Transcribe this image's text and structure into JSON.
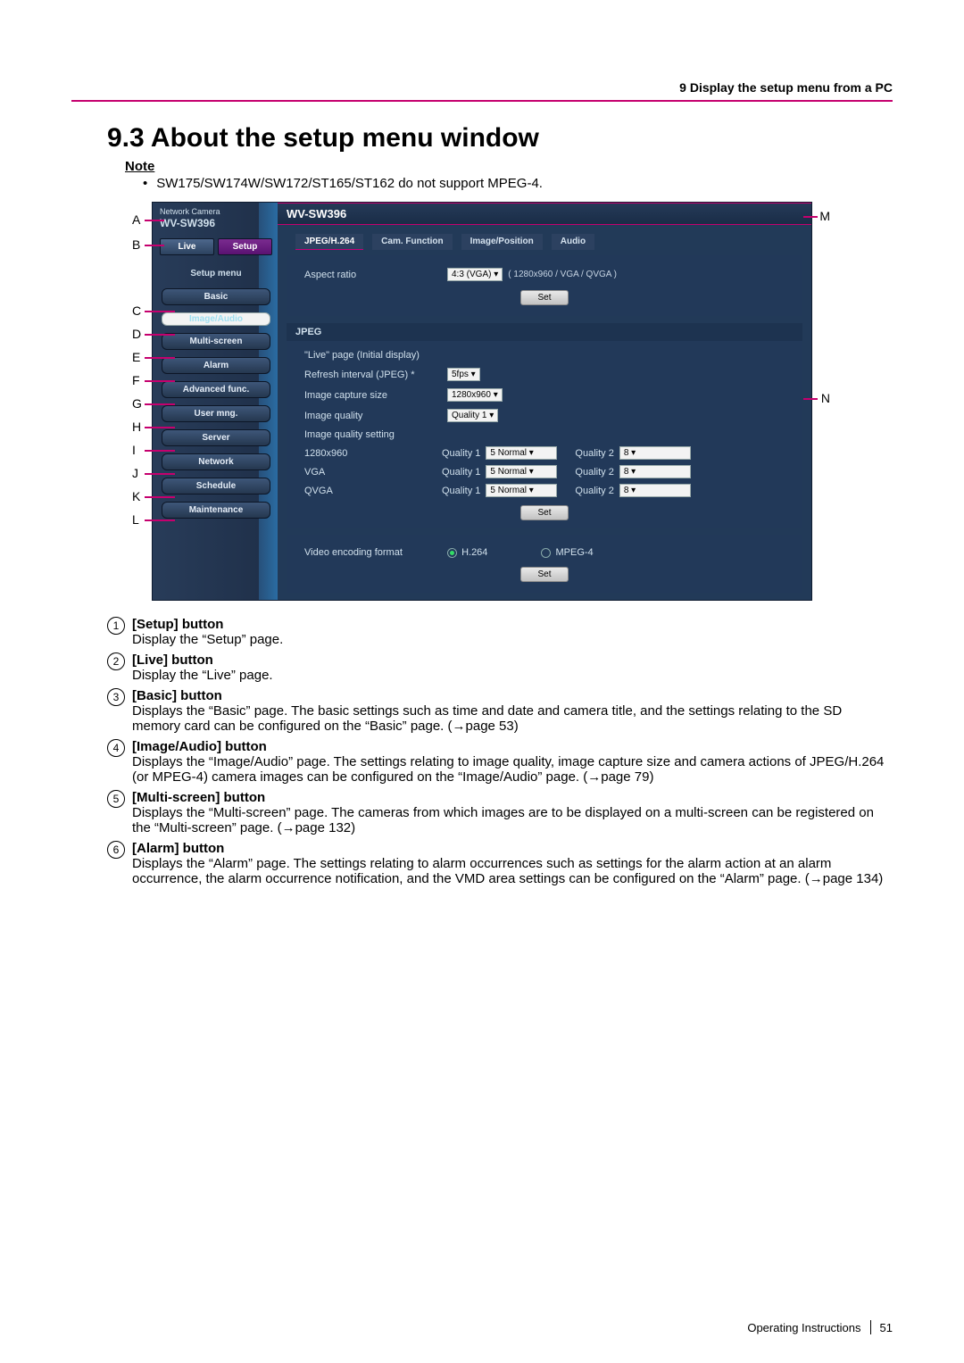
{
  "header": {
    "breadcrumb": "9 Display the setup menu from a PC",
    "h1": "9.3   About the setup menu window"
  },
  "note": {
    "heading": "Note",
    "bullet": "•",
    "text": "SW175/SW174W/SW172/ST165/ST162 do not support MPEG-4."
  },
  "markers_left": [
    "A",
    "B",
    "C",
    "D",
    "E",
    "F",
    "G",
    "H",
    "I",
    "J",
    "K",
    "L"
  ],
  "markers_right": [
    "M",
    "N"
  ],
  "cam": {
    "brand_line": "Network Camera",
    "brand_model": "WV-SW396",
    "titlebar": "WV-SW396",
    "tabs": {
      "live": "Live",
      "setup": "Setup"
    },
    "menu_title": "Setup menu",
    "menu": [
      "Basic",
      "Image/Audio",
      "Multi-screen",
      "Alarm",
      "Advanced func.",
      "User mng.",
      "Server",
      "Network",
      "Schedule",
      "Maintenance"
    ],
    "subtabs": [
      "JPEG/H.264",
      "Cam. Function",
      "Image/Position",
      "Audio"
    ],
    "aspect": {
      "label": "Aspect ratio",
      "value": "4:3 (VGA)",
      "hint": "( 1280x960 / VGA / QVGA )"
    },
    "set_btn": "Set",
    "jpeg_head": "JPEG",
    "live_init": "\"Live\" page (Initial display)",
    "refresh": {
      "label": "Refresh interval (JPEG) *",
      "value": "5fps"
    },
    "capture": {
      "label": "Image capture size",
      "value": "1280x960"
    },
    "iq": {
      "label": "Image quality",
      "value": "Quality 1"
    },
    "iq_head": "Image quality setting",
    "iq_rows": [
      {
        "size": "1280x960",
        "q1l": "Quality 1",
        "q1": "5 Normal",
        "q2l": "Quality 2",
        "q2": "8"
      },
      {
        "size": "VGA",
        "q1l": "Quality 1",
        "q1": "5 Normal",
        "q2l": "Quality 2",
        "q2": "8"
      },
      {
        "size": "QVGA",
        "q1l": "Quality 1",
        "q1": "5 Normal",
        "q2l": "Quality 2",
        "q2": "8"
      }
    ],
    "enc": {
      "label": "Video encoding format",
      "h264": "H.264",
      "mpeg4": "MPEG-4"
    }
  },
  "defs": [
    {
      "n": "1",
      "title": "[Setup] button",
      "body": "Display the “Setup” page."
    },
    {
      "n": "2",
      "title": "[Live] button",
      "body": "Display the “Live” page."
    },
    {
      "n": "3",
      "title": "[Basic] button",
      "body": "Displays the “Basic” page. The basic settings such as time and date and camera title, and the settings relating to the SD memory card can be configured on the “Basic” page. (→page 53)"
    },
    {
      "n": "4",
      "title": "[Image/Audio] button",
      "body": "Displays the “Image/Audio” page. The settings relating to image quality, image capture size and camera actions of JPEG/H.264 (or MPEG-4) camera images can be configured on the “Image/Audio” page. (→page 79)"
    },
    {
      "n": "5",
      "title": "[Multi-screen] button",
      "body": "Displays the “Multi-screen” page. The cameras from which images are to be displayed on a multi-screen can be registered on the “Multi-screen” page. (→page 132)"
    },
    {
      "n": "6",
      "title": "[Alarm] button",
      "body": "Displays the “Alarm” page. The settings relating to alarm occurrences such as settings for the alarm action at an alarm occurrence, the alarm occurrence notification, and the VMD area settings can be configured on the “Alarm” page. (→page 134)"
    }
  ],
  "footer": {
    "label": "Operating Instructions",
    "page": "51"
  }
}
